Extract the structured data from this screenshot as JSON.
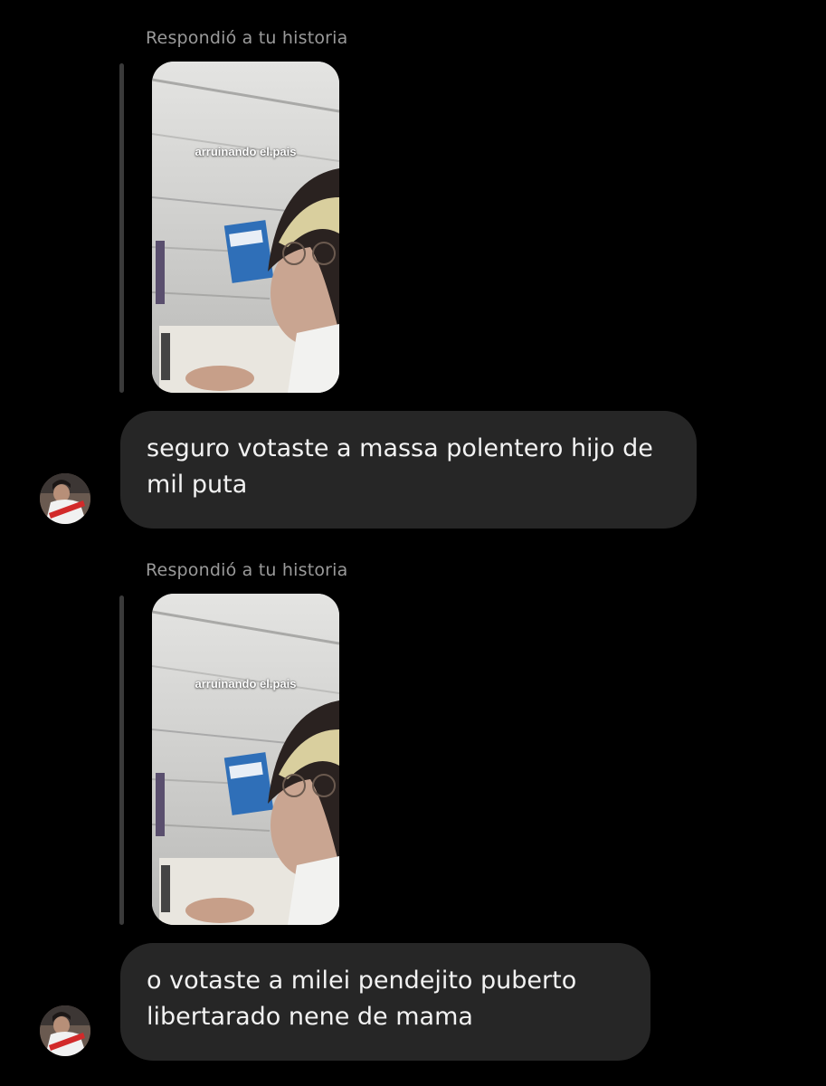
{
  "messages": [
    {
      "reply_label": "Respondió a tu historia",
      "story_caption": "arruinando el.pais",
      "text": "seguro votaste a massa polentero hijo de mil puta"
    },
    {
      "reply_label": "Respondió a tu historia",
      "story_caption": "arruinando el.pais",
      "text": "o votaste a milei pendejito puberto libertarado nene de mama"
    }
  ],
  "colors": {
    "background": "#000000",
    "bubble": "#262626",
    "label": "#9a9a9a"
  }
}
